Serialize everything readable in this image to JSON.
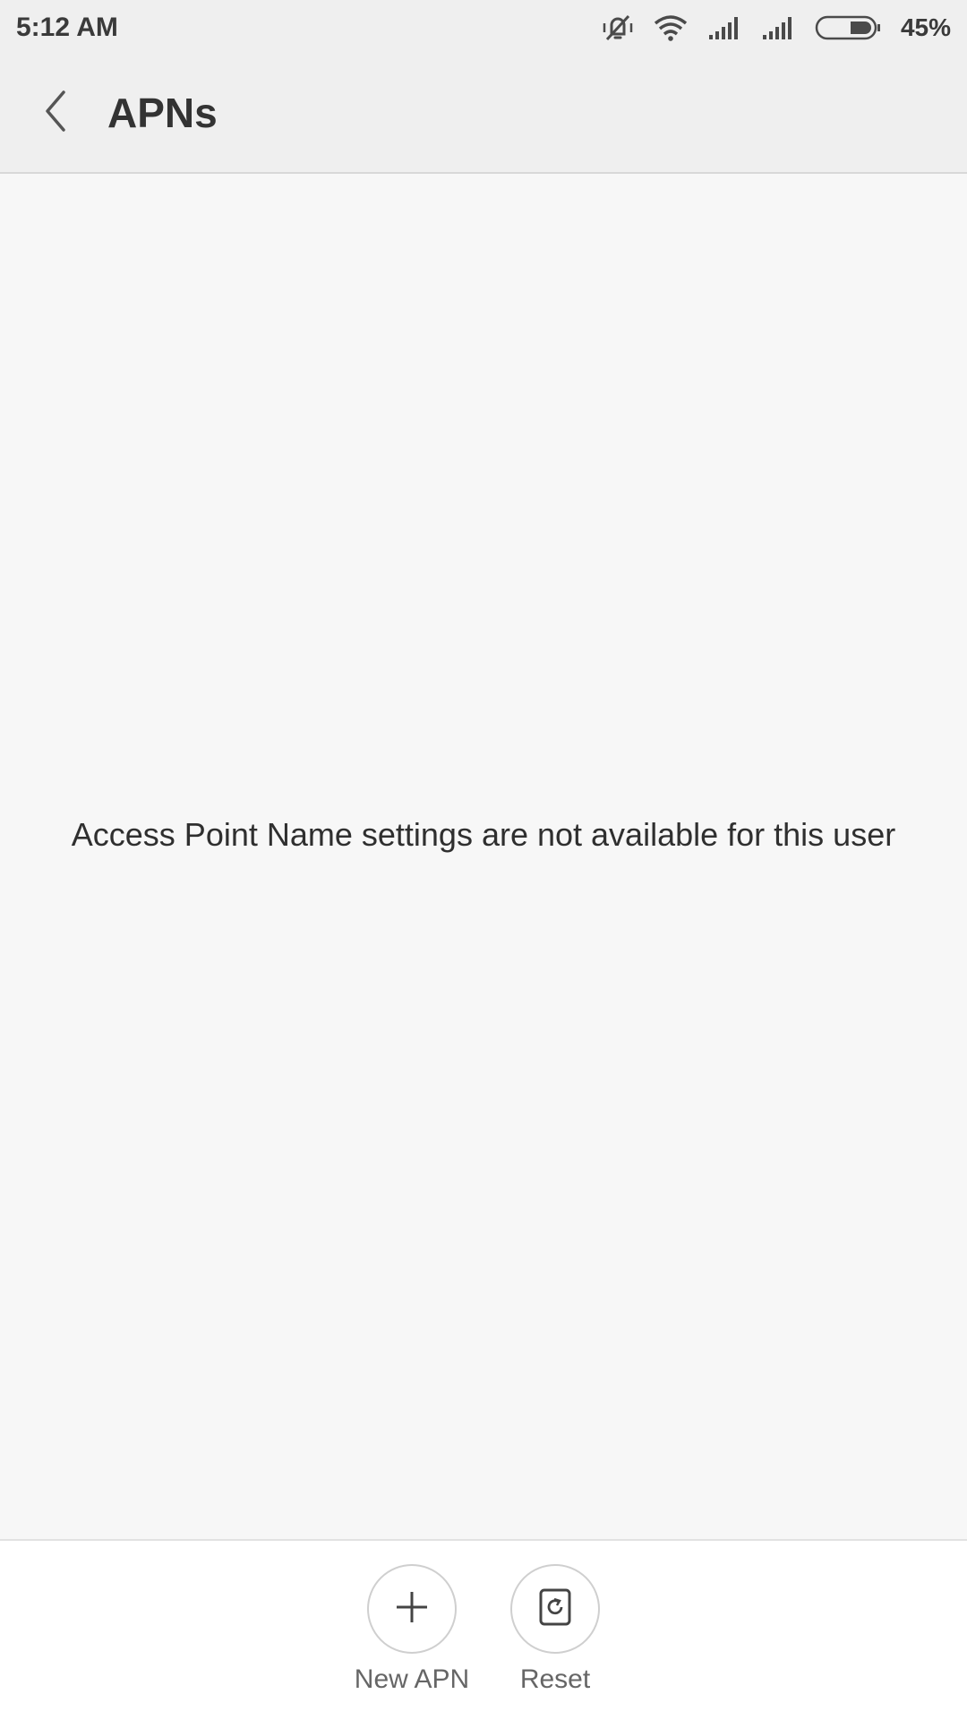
{
  "status_bar": {
    "time": "5:12 AM",
    "battery_percent": "45%",
    "icons": [
      "vibrate-off-icon",
      "wifi-icon",
      "signal-icon",
      "signal-icon",
      "battery-icon"
    ]
  },
  "header": {
    "title": "APNs",
    "back_icon": "chevron-left-icon"
  },
  "main": {
    "empty_message": "Access Point Name settings are not available for this user"
  },
  "bottom_bar": {
    "actions": [
      {
        "label": "New APN",
        "icon": "plus-icon"
      },
      {
        "label": "Reset",
        "icon": "reset-icon"
      }
    ]
  },
  "colors": {
    "header_bg": "#efefef",
    "content_bg": "#f7f7f7",
    "bottom_bg": "#ffffff",
    "text_primary": "#333333",
    "text_secondary": "#666666"
  }
}
